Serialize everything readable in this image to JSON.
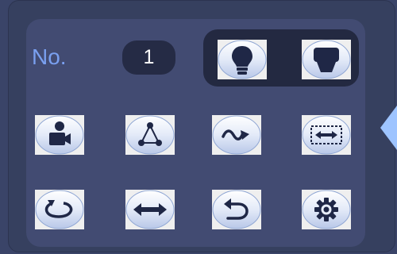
{
  "preset": {
    "label": "No.",
    "value": "1"
  },
  "icons": {
    "light": "light-bulb-icon",
    "wiper": "wiper-icon",
    "camera_person": "camera-person-icon",
    "triangle": "triangle-nodes-icon",
    "wave_arrow": "wave-arrow-icon",
    "dashed_arrow": "dashed-box-arrow-icon",
    "circular": "circular-arrow-icon",
    "left_right": "left-right-arrow-icon",
    "return": "return-arrow-icon",
    "settings": "gear-icon",
    "side_tab": "expand-arrow-icon"
  },
  "colors": {
    "background": "#3a4468",
    "panel": "#424b72",
    "group": "#232941",
    "label": "#7aa0f0",
    "accent": "#9ec4ff"
  }
}
